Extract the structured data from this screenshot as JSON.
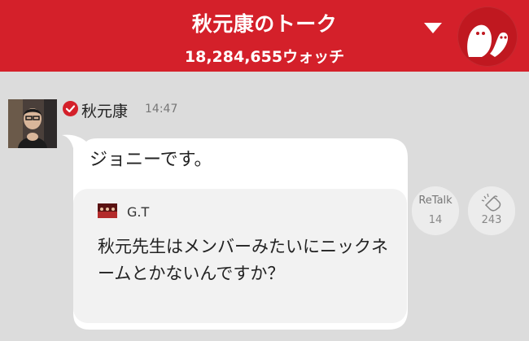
{
  "header": {
    "title": "秋元康のトーク",
    "watch_count": "18,284,655ウォッチ"
  },
  "message": {
    "author": "秋元康",
    "time": "14:47",
    "text": "ジョニーです。"
  },
  "quote": {
    "author": "G.T",
    "text": "秋元先生はメンバーみたいにニックネームとかないんですか？"
  },
  "actions": {
    "retalk_label": "ReTalk",
    "retalk_count": "14",
    "clap_count": "243"
  },
  "colors": {
    "brand": "#d4202a",
    "background": "#dcdcdc",
    "verified": "#d4202a"
  }
}
